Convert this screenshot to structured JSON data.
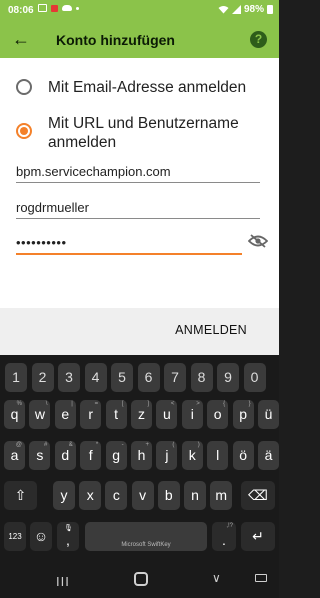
{
  "status": {
    "time": "08:06",
    "battery": "98%",
    "notification_icons": [
      "image-icon",
      "red-app-icon",
      "cloud-icon",
      "dot-icon"
    ],
    "system_icons": [
      "wifi-icon",
      "signal-icon",
      "battery-icon"
    ]
  },
  "appbar": {
    "title": "Konto hinzufügen",
    "back_icon": "←",
    "help_icon": "?",
    "color": "#8bc34a"
  },
  "options": [
    {
      "label": "Mit Email-Adresse anmelden",
      "selected": false
    },
    {
      "label": "Mit URL und Benutzername anmelden",
      "selected": true
    }
  ],
  "fields": {
    "url": "bpm.servicechampion.com",
    "username": "rogdrmueller",
    "password": "••••••••••"
  },
  "button": {
    "label": "ANMELDEN"
  },
  "accent_color": "#f4812a",
  "keyboard": {
    "brand": "Microsoft SwiftKey",
    "numbers": [
      "1",
      "2",
      "3",
      "4",
      "5",
      "6",
      "7",
      "8",
      "9",
      "0"
    ],
    "row1": [
      "q",
      "w",
      "e",
      "r",
      "t",
      "z",
      "u",
      "i",
      "o",
      "p",
      "ü"
    ],
    "row1_hints": [
      "%",
      "\\",
      "|",
      "=",
      "[",
      "]",
      "<",
      ">",
      "{",
      "}",
      ""
    ],
    "row2": [
      "a",
      "s",
      "d",
      "f",
      "g",
      "h",
      "j",
      "k",
      "l",
      "ö",
      "ä"
    ],
    "row2_hints": [
      "@",
      "#",
      "&",
      "*",
      "-",
      "+",
      "(",
      ")",
      "",
      "",
      ""
    ],
    "row3": [
      "y",
      "x",
      "c",
      "v",
      "b",
      "n",
      "m"
    ],
    "row3_hints": [
      "",
      "",
      "",
      "",
      "",
      "",
      ""
    ],
    "symbols_key": "123",
    "emoji_key": "☺",
    "comma_key": ",",
    "mic_icon": "🎙",
    "period_key": ".",
    "period_hint": ",!?",
    "shift_icon": "⇧",
    "backspace_icon": "⌫",
    "enter_icon": "↵"
  },
  "navbar": {
    "recent": "III",
    "back": "∨"
  }
}
